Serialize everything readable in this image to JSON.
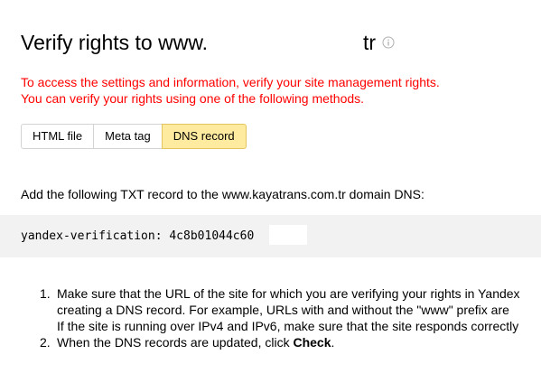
{
  "header": {
    "title": "Verify rights to www.",
    "title_tail": "tr",
    "info_icon": "info-circle-icon"
  },
  "notice": {
    "line1": "To access the settings and information, verify your site management rights.",
    "line2": "You can verify your rights using one of the following methods.",
    "color": "#ff0000"
  },
  "tabs": [
    {
      "label": "HTML file",
      "active": false
    },
    {
      "label": "Meta tag",
      "active": false
    },
    {
      "label": "DNS record",
      "active": true
    }
  ],
  "instruction": "Add the following TXT record to the www.kayatrans.com.tr domain DNS:",
  "record": {
    "value": "yandex-verification: 4c8b01044c60"
  },
  "steps": [
    {
      "number": "1.",
      "lines": [
        "Make sure that the URL of the site for which you are verifying your rights in Yandex",
        "creating a DNS record. For example, URLs with and without the \"www\" prefix are",
        "If the site is running over IPv4 and IPv6, make sure that the site responds correctly"
      ]
    },
    {
      "number": "2.",
      "text_before": "When the DNS records are updated, click ",
      "bold": "Check",
      "text_after": "."
    }
  ],
  "colors": {
    "active_tab_bg": "#ffeba0",
    "record_bg": "#f2f2f2"
  }
}
